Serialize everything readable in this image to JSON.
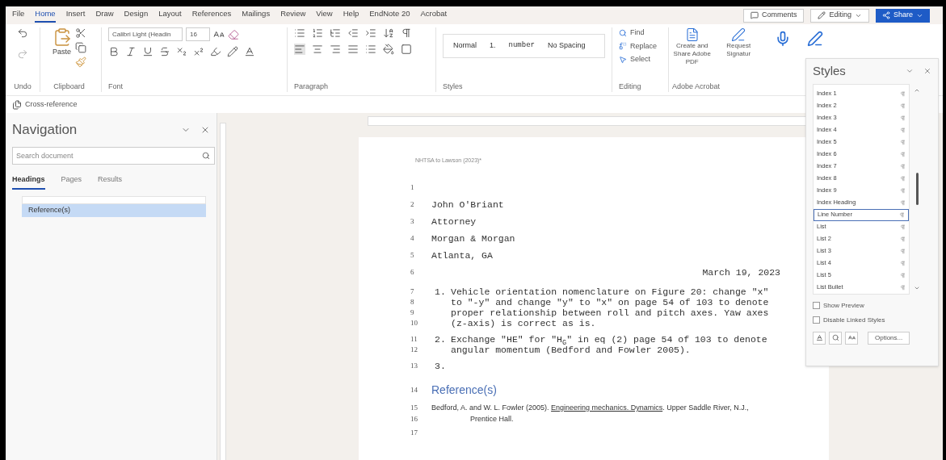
{
  "menu_tabs": [
    {
      "label": "File",
      "selected": false
    },
    {
      "label": "Home",
      "selected": true
    },
    {
      "label": "Insert",
      "selected": false
    },
    {
      "label": "Draw",
      "selected": false
    },
    {
      "label": "Design",
      "selected": false
    },
    {
      "label": "Layout",
      "selected": false
    },
    {
      "label": "References",
      "selected": false
    },
    {
      "label": "Mailings",
      "selected": false
    },
    {
      "label": "Review",
      "selected": false
    },
    {
      "label": "View",
      "selected": false
    },
    {
      "label": "Help",
      "selected": false
    },
    {
      "label": "EndNote 20",
      "selected": false
    },
    {
      "label": "Acrobat",
      "selected": false
    }
  ],
  "header_buttons": {
    "comments": "Comments",
    "editing": "Editing",
    "share": "Share"
  },
  "ribbon": {
    "paste": "Paste",
    "font_name": "Calibri Light (Headin",
    "font_size": "16",
    "styles_gallery": [
      "Normal",
      "1.",
      "number",
      "No Spacing"
    ],
    "editing": [
      "Find",
      "Replace",
      "Select"
    ],
    "acrobat": [
      "Create and Share Adobe PDF",
      "Request Signatur"
    ],
    "group_labels": [
      "Undo",
      "Clipboard",
      "Font",
      "Paragraph",
      "Styles",
      "Editing",
      "Adobe Acrobat"
    ]
  },
  "cross_reference": "Cross-reference",
  "navigation": {
    "title": "Navigation",
    "search_placeholder": "Search document",
    "tabs": [
      {
        "label": "Headings",
        "selected": true
      },
      {
        "label": "Pages",
        "selected": false
      },
      {
        "label": "Results",
        "selected": false
      }
    ],
    "headings": [
      {
        "label": "Reference(s)",
        "selected": true
      }
    ]
  },
  "document": {
    "header": "NHTSA to Lawson (2023)*",
    "lines": [
      {
        "number": "1",
        "kind": "blank"
      },
      {
        "number": "2",
        "kind": "plain",
        "text": "John O'Briant"
      },
      {
        "number": "3",
        "kind": "plain",
        "text": "Attorney"
      },
      {
        "number": "4",
        "kind": "plain",
        "text": "Morgan & Morgan"
      },
      {
        "number": "5",
        "kind": "plain",
        "text": "Atlanta, GA"
      },
      {
        "number": "6",
        "kind": "right",
        "text": "March 19, 2023"
      },
      {
        "number": "7",
        "kind": "list",
        "marker": "1.",
        "text": "Vehicle orientation nomenclature on Figure 20: change \"x\""
      },
      {
        "number": "8",
        "kind": "list_cont",
        "text": "to \"-y\" and change \"y\" to \"x\" on page 54 of 103 to denote"
      },
      {
        "number": "9",
        "kind": "list_cont",
        "text": "proper relationship between roll and pitch axes. Yaw axes"
      },
      {
        "number": "10",
        "kind": "list_cont",
        "text": "(z-axis) is correct as is."
      },
      {
        "number": "11",
        "kind": "list",
        "marker": "2.",
        "text": "Exchange \"HE\" for \"H$_{G}$\" in eq (2) page 54 of 103 to denote"
      },
      {
        "number": "12",
        "kind": "list_cont",
        "text": "angular momentum (Bedford and Fowler 2005)."
      },
      {
        "number": "13",
        "kind": "list",
        "marker": "3."
      },
      {
        "number": "14",
        "kind": "heading",
        "text": "Reference(s)"
      },
      {
        "number": "15",
        "kind": "reference",
        "before": "Bedford, A. and W. L. Fowler (2005). ",
        "title": "Engineering mechanics. Dynamics",
        "after": ". Upper Saddle River, N.J.,"
      },
      {
        "number": "16",
        "kind": "reference_cont",
        "text": "Prentice Hall."
      },
      {
        "number": "17",
        "kind": "blank"
      }
    ]
  },
  "styles_pane": {
    "title": "Styles",
    "items": [
      {
        "label": "Index 1",
        "selected": false
      },
      {
        "label": "Index 2",
        "selected": false
      },
      {
        "label": "Index 3",
        "selected": false
      },
      {
        "label": "Index 4",
        "selected": false
      },
      {
        "label": "Index 5",
        "selected": false
      },
      {
        "label": "Index 6",
        "selected": false
      },
      {
        "label": "Index 7",
        "selected": false
      },
      {
        "label": "Index 8",
        "selected": false
      },
      {
        "label": "Index 9",
        "selected": false
      },
      {
        "label": "Index Heading",
        "selected": false
      },
      {
        "label": "Line Number",
        "selected": true
      },
      {
        "label": "List",
        "selected": false
      },
      {
        "label": "List 2",
        "selected": false
      },
      {
        "label": "List 3",
        "selected": false
      },
      {
        "label": "List 4",
        "selected": false
      },
      {
        "label": "List 5",
        "selected": false
      },
      {
        "label": "List Bullet",
        "selected": false
      }
    ],
    "options": [
      {
        "label": "Show Preview",
        "checked": false
      },
      {
        "label": "Disable Linked Styles",
        "checked": false
      }
    ],
    "options_button": "Options..."
  }
}
